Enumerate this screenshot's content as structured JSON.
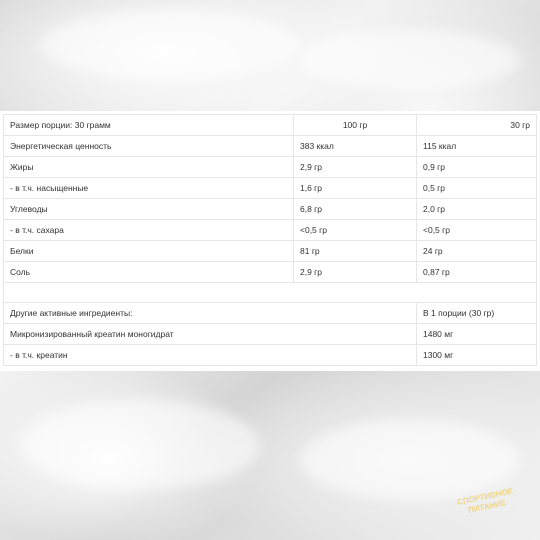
{
  "header": {
    "label": "Размер порции: 30 грамм",
    "col_100": "100 гр",
    "col_30": "30 гр"
  },
  "nutrition": [
    {
      "name": "Энергетическая ценность",
      "v100": "383 ккал",
      "v30": "115 ккал"
    },
    {
      "name": "Жиры",
      "v100": "2,9 гр",
      "v30": "0,9 гр"
    },
    {
      "name": "- в т.ч. насыщенные",
      "v100": "1,6 гр",
      "v30": "0,5 гр"
    },
    {
      "name": "Углеводы",
      "v100": "6,8 гр",
      "v30": "2,0 гр"
    },
    {
      "name": "- в т.ч. сахара",
      "v100": "<0,5 гр",
      "v30": "<0,5 гр"
    },
    {
      "name": "Белки",
      "v100": "81 гр",
      "v30": "24 гр"
    },
    {
      "name": "Соль",
      "v100": "2,9 гр",
      "v30": "0,87 гр"
    }
  ],
  "active": {
    "header_label": "Другие активные ингредиенты:",
    "header_value": "В 1 порции (30 гр)",
    "rows": [
      {
        "name": "Микронизированный креатин моногидрат",
        "value": "1480 мг"
      },
      {
        "name": "- в т.ч. креатин",
        "value": "1300 мг"
      }
    ]
  },
  "watermark": {
    "text": "СПОРТИВНОЕ ПИТАНИЕ"
  }
}
